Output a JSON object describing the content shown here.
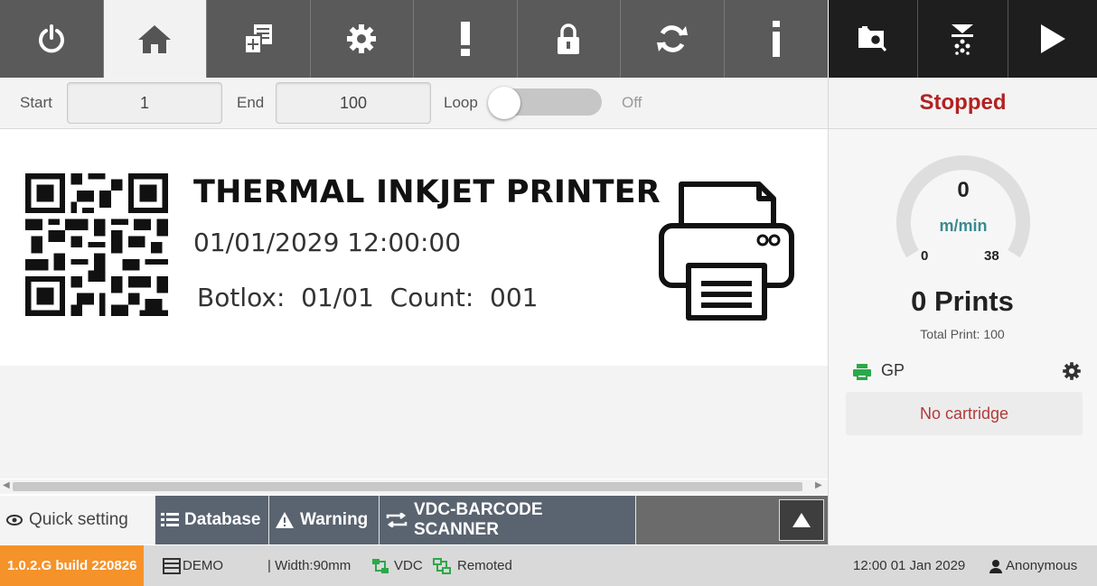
{
  "toolbar": {
    "items": [
      {
        "name": "power-icon"
      },
      {
        "name": "home-icon"
      },
      {
        "name": "new-message-icon"
      },
      {
        "name": "settings-icon"
      },
      {
        "name": "alert-icon"
      },
      {
        "name": "lock-icon"
      },
      {
        "name": "refresh-icon"
      },
      {
        "name": "info-icon"
      }
    ],
    "active_index": 1,
    "right_items": [
      {
        "name": "folder-search-icon"
      },
      {
        "name": "purge-icon"
      },
      {
        "name": "play-icon"
      }
    ]
  },
  "range": {
    "start_label": "Start",
    "start_value": "1",
    "end_label": "End",
    "end_value": "100",
    "loop_label": "Loop",
    "loop_state": "Off"
  },
  "status": {
    "text": "Stopped",
    "color": "#b22222"
  },
  "preview": {
    "title": "THERMAL INKJET PRINTER",
    "datetime": "01/01/2029 12:00:00",
    "botlox_line": "Botlox:  01/01  Count:  001"
  },
  "tabs": [
    {
      "label": "Quick setting",
      "icon": "eye-settings-icon",
      "active": true
    },
    {
      "label": "Database",
      "icon": "database-grid-icon",
      "active": false
    },
    {
      "label": "Warning",
      "icon": "warning-icon",
      "active": false
    },
    {
      "label": "VDC-BARCODE SCANNER",
      "icon": "transfer-icon",
      "active": false
    }
  ],
  "speed": {
    "value": "0",
    "unit": "m/min",
    "min": "0",
    "max": "38",
    "fraction": 0
  },
  "prints": {
    "count_text": "0 Prints",
    "total_text": "Total Print: 100"
  },
  "cartridge": {
    "name": "GP",
    "status": "No cartridge",
    "icon_color": "#2ca84a"
  },
  "statusbar": {
    "version": "1.0.2.G build 220826",
    "mode": "DEMO",
    "width": "| Width:90mm",
    "vdc": "VDC",
    "remoted": "Remoted",
    "datetime": "12:00 01 Jan 2029",
    "user": "Anonymous"
  }
}
